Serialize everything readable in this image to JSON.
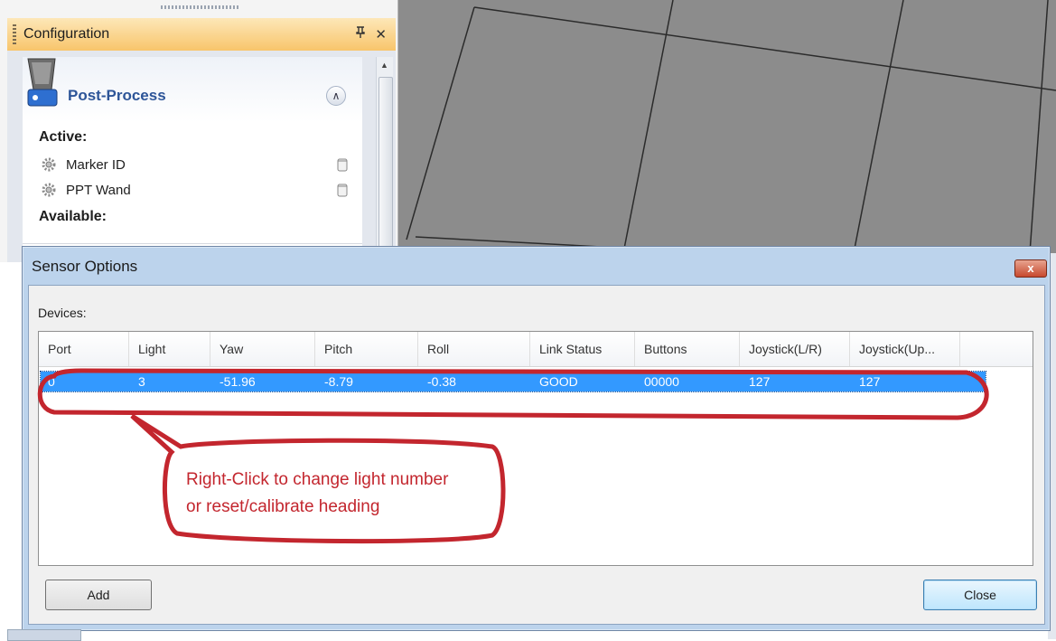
{
  "config": {
    "title": "Configuration",
    "pin_glyph": "⬇",
    "close_glyph": "✕",
    "post_process_title": "Post-Process",
    "collapse_glyph": "∧",
    "active_label": "Active:",
    "available_label": "Available:",
    "active_items": [
      {
        "label": "Marker ID",
        "icon": "gear-icon"
      },
      {
        "label": "PPT Wand",
        "icon": "gear-icon"
      }
    ]
  },
  "dialog": {
    "title": "Sensor Options",
    "close_glyph": "x",
    "devices_label": "Devices:",
    "columns": [
      "Port",
      "Light",
      "Yaw",
      "Pitch",
      "Roll",
      "Link Status",
      "Buttons",
      "Joystick(L/R)",
      "Joystick(Up..."
    ],
    "rows": [
      {
        "port": "0",
        "light": "3",
        "yaw": "-51.96",
        "pitch": "-8.79",
        "roll": "-0.38",
        "link_status": "GOOD",
        "buttons": "00000",
        "joystick_lr": "127",
        "joystick_ud": "127"
      }
    ],
    "add_label": "Add",
    "close_label": "Close"
  },
  "annotation": {
    "line1": "Right-Click to change light number",
    "line2": "or reset/calibrate heading",
    "color": "#c3262e"
  },
  "colors": {
    "selection": "#3399ff",
    "header_orange": "#f8c56b",
    "viewport_gray": "#8c8c8c"
  }
}
